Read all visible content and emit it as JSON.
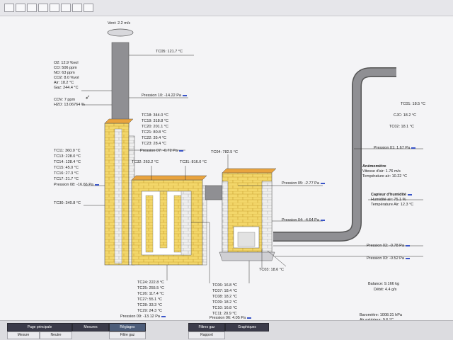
{
  "vent": "Vent: 2.2 m/s",
  "gases": {
    "o2": "O2: 12.9 %vol",
    "co": "CO: 506 ppm",
    "no": "NO: 63 ppm",
    "co2": "CO2: 8.0 %vol",
    "air": "Air: 18.2 °C",
    "gaz": "Gaz: 244.4 °C",
    "cov": "COV: 7 ppm",
    "h2o": "H2O: 13.06764 %"
  },
  "chimney": {
    "tc05": "TC05: 121.7 °C",
    "pression10": "Pression 10: -14.22 Pa"
  },
  "upper_col": [
    "TC18: 344.0 °C",
    "TC19: 318.8 °C",
    "TC20: 201.1 °C",
    "TC21: 80.8 °C",
    "TC22: 35.4 °C",
    "TC23: 28.4 °C"
  ],
  "pression07": "Pression 07: -0.72 Pa",
  "left_col": [
    "TC11: 360.0 °C",
    "TC13: 228.0 °C",
    "TC14: 128.4 °C",
    "TC15: 45.0 °C",
    "TC16: 27.3 °C",
    "TC17: 21.7 °C"
  ],
  "pression08": "Pression 08: -16.66 Pa",
  "tc30": "TC30: 340.8 °C",
  "tc32": "TC32: 263.2 °C",
  "tc31": "TC31: 816.0 °C",
  "tc04": "TC04: 782.5 °C",
  "pression05": "Pression 05: -2.77 Pa",
  "pression04": "Pression 04: -4.64 Pa",
  "bottom_col": [
    "TC24: 222.8 °C",
    "TC25: 255.5 °C",
    "TC26: 117.4 °C",
    "TC27: 55.1 °C",
    "TC28: 33.3 °C",
    "TC29: 24.3 °C"
  ],
  "pression09": "Pression 09: -13.12 Pa",
  "right_col": [
    "TC06: 16.8 °C",
    "TC07: 18.4 °C",
    "TC08: 18.2 °C",
    "TC09: 18.2 °C",
    "TC10: 16.8 °C",
    "TC11: 20.9 °C"
  ],
  "pression06": "Pression 06: 4.05 Pa",
  "tc03": "TC03: 18.6 °C",
  "balance": "Balance: 9.166 kg",
  "debit": "Débit: 4.4 g/s",
  "pression02": "Pression 02: -0.78 Pa",
  "pression03": "Pression 03: -0.52 Pa",
  "tc01": "TC01: 18.5 °C",
  "cjc": "CJC: 18.2 °C",
  "tc02": "TC02: 18.1 °C",
  "pression01": "Pression 01: 1.67 Pa",
  "anemometre": {
    "title": "Anémomètre",
    "vitesse": "Vitesse d'air: 1.76 m/s",
    "temp": "Température air: 10.22 °C"
  },
  "humidite": {
    "title": "Capteur d'humidité",
    "hum": "Humidité air: 75.1 %",
    "temp": "Température Air: 12.3 °C"
  },
  "barometre": {
    "bar": "Baromètre: 1008.31 hPa",
    "air": "Air extérieur: 9.6 °C"
  },
  "bottom_tabs": [
    "Page principale",
    "Mesures",
    "Réglages",
    "Filtres gaz",
    "Graphiques"
  ],
  "bottom_sub": [
    "Mesure",
    "Neutre",
    "Filtre gaz",
    "Rapport"
  ],
  "colors": {
    "brick_yellow": "#f3d76a",
    "brick_orange": "#e9a33d",
    "pipe_gray": "#8f8f93",
    "label_link": "#3a55c8"
  }
}
